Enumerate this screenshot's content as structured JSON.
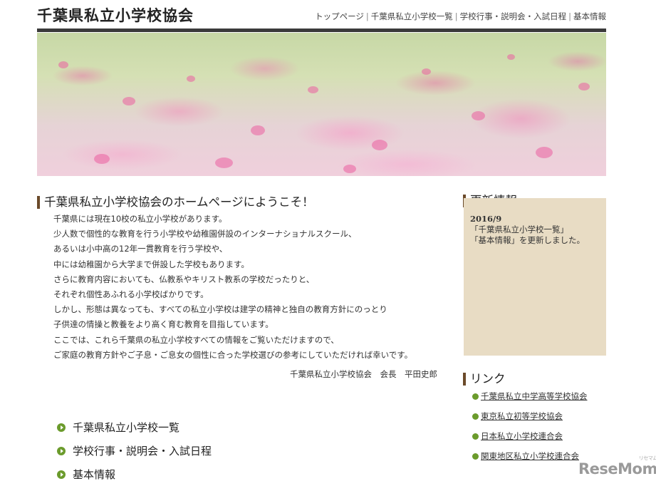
{
  "site": {
    "title": "千葉県私立小学校協会"
  },
  "nav": {
    "items": [
      "トップページ",
      "千葉県私立小学校一覧",
      "学校行事・説明会・入試日程",
      "基本情報"
    ]
  },
  "welcome": {
    "heading": "千葉県私立小学校協会のホームページにようこそ！",
    "lines": [
      "千葉県には現在10校の私立小学校があります。",
      "少人数で個性的な教育を行う小学校や幼稚園併設のインターナショナルスクール、",
      "あるいは小中高の12年一貫教育を行う学校や、",
      "中には幼稚園から大学まで併設した学校もあります。",
      "さらに教育内容においても、仏教系やキリスト教系の学校だったりと、",
      "それぞれ個性あふれる小学校ばかりです。",
      "しかし、形態は異なっても、すべての私立小学校は建学の精神と独自の教育方針にのっとり",
      "子供達の情操と教養をより高く育む教育を目指しています。",
      "ここでは、これら千葉県の私立小学校すべての情報をご覧いただけますので、",
      "ご家庭の教育方針やご子息・ご息女の個性に合った学校選びの参考にしていただければ幸いです。"
    ],
    "signature": "千葉県私立小学校協会　会長　平田史郎"
  },
  "main_links": [
    "千葉県私立小学校一覧",
    "学校行事・説明会・入試日程",
    "基本情報"
  ],
  "news": {
    "heading": "更新情報",
    "date": "2016/9",
    "lines": [
      "「千葉県私立小学校一覧」",
      "「基本情報」を更新しました。"
    ]
  },
  "links": {
    "heading": "リンク",
    "items": [
      "千葉県私立中学高等学校協会",
      "東京私立初等学校協会",
      "日本私立小学校連合会",
      "関東地区私立小学校連合会"
    ]
  },
  "watermark": {
    "text": "ReseMom",
    "small": "リセマム"
  }
}
